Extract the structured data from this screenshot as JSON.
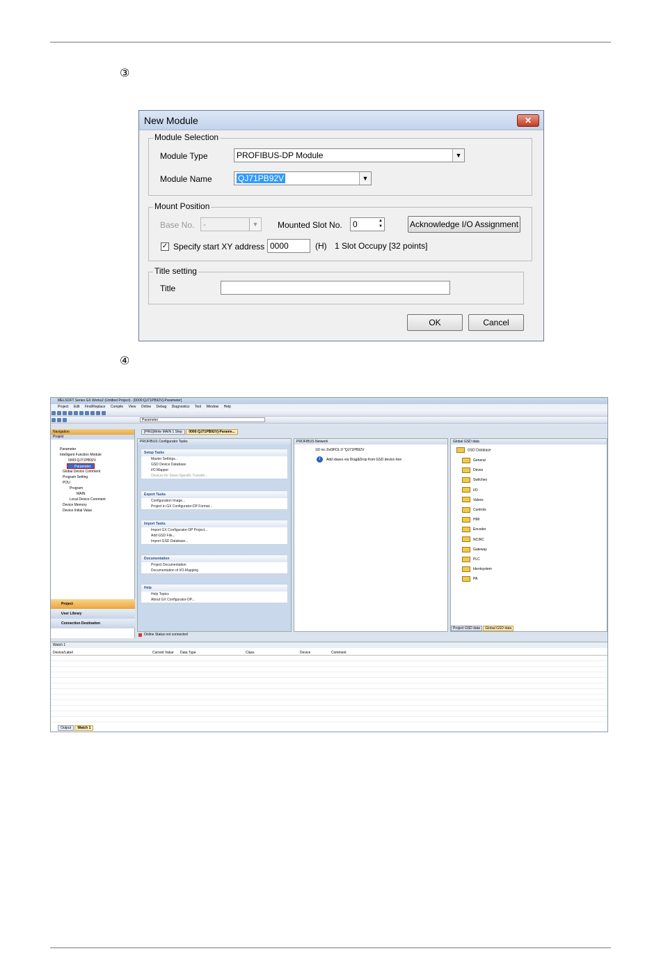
{
  "steps": {
    "s3": "③",
    "s4": "④"
  },
  "dialog": {
    "title": "New Module",
    "close": "✕",
    "module_selection": {
      "caption": "Module Selection",
      "type_label": "Module Type",
      "type_value": "PROFIBUS-DP Module",
      "name_label": "Module Name",
      "name_value": "QJ71PB92V"
    },
    "mount": {
      "caption": "Mount Position",
      "base_label": "Base No.",
      "base_value": "-",
      "slot_label": "Mounted Slot No.",
      "slot_value": "0",
      "ack_button": "Acknowledge I/O Assignment",
      "specify_label": "Specify start XY address",
      "specify_checked": true,
      "xy_value": "0000",
      "hex_label": "(H)",
      "occupy_text": "1 Slot Occupy [32 points]"
    },
    "title_setting": {
      "caption": "Title setting",
      "label": "Title",
      "value": ""
    },
    "ok": "OK",
    "cancel": "Cancel"
  },
  "gx": {
    "title": "MELSOFT Series GX Works2 (Untitled Project) - [0000:QJ71PB92V]-Parameter]",
    "menu": [
      "Project",
      "Edit",
      "Find/Replace",
      "Compile",
      "View",
      "Online",
      "Debug",
      "Diagnostics",
      "Tool",
      "Window",
      "Help"
    ],
    "combo": "Parameter",
    "tabs": [
      "[PRG]Write MAIN 1 Step",
      "0000:QJ71PB92V]-Parame..."
    ],
    "navigation": {
      "header": "Navigation",
      "sub": "Project",
      "tree": [
        "Parameter",
        "Intelligent Function Module",
        "0000:QJ71PB92V",
        "Parameter",
        "Global Device Comment",
        "Program Setting",
        "POU",
        "Program",
        "MAIN",
        "Local Device Comment",
        "Device Memory",
        "Device Initial Value"
      ],
      "buttons": [
        "Project",
        "User Library",
        "Connection Destination"
      ]
    },
    "config_tasks": {
      "header": "PROFIBUS Configurator Tasks",
      "groups": [
        {
          "title": "Setup Tasks",
          "items": [
            "Master Settings...",
            "GSD Device Database",
            "I/O Mapper",
            "Devices for Slave-Specific Transfer..."
          ]
        },
        {
          "title": "Export Tasks",
          "items": [
            "Configuration Image...",
            "Project in GX Configurator-DP Format..."
          ]
        },
        {
          "title": "Import Tasks",
          "items": [
            "Import GX Configurator-DP Project...",
            "Add GSD File...",
            "Import GSD Database..."
          ]
        },
        {
          "title": "Documentation",
          "items": [
            "Project Documentation",
            "Documentation of I/O-Mapping"
          ]
        },
        {
          "title": "Help",
          "items": [
            "Help Topics",
            "About GX Configurator-DP..."
          ]
        }
      ]
    },
    "network": {
      "header": "PROFIBUS Network",
      "node": "1/0 no.:0x0/FDL:0 \"QJ71PB92V",
      "hint": "Add slaves via Drag&Drop from GSD device tree"
    },
    "gsd": {
      "header": "Global GSD data",
      "root": "GSD Database",
      "folders": [
        "General",
        "Drives",
        "Switches",
        "I/O",
        "Valves",
        "Controls",
        "HMI",
        "Encoder",
        "NC/RC",
        "Gateway",
        "PLC",
        "Identsystem",
        "PA"
      ],
      "tabs": [
        "Project GSD data",
        "Global GSD data"
      ]
    },
    "status": "Online Status not connected",
    "watch": {
      "header": "Watch 1",
      "columns": [
        "Device/Label",
        "Current Value",
        "Data Type",
        "Class",
        "Device",
        "Comment"
      ],
      "tabs": [
        "Output",
        "Watch 1"
      ]
    }
  }
}
